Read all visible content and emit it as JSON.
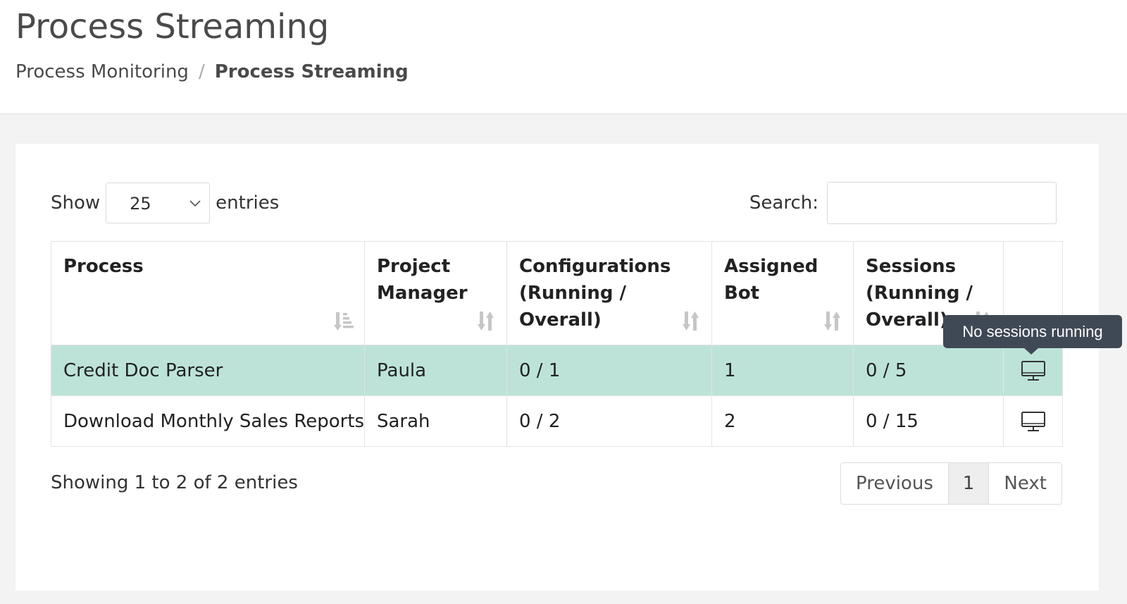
{
  "page": {
    "title": "Process Streaming",
    "breadcrumb": [
      {
        "label": "Process Monitoring"
      },
      {
        "separator": "/"
      },
      {
        "label": "Process Streaming"
      }
    ]
  },
  "controls": {
    "show_label": "Show",
    "entries_label": "entries",
    "page_length": "25",
    "search_label": "Search:",
    "search_value": ""
  },
  "table": {
    "columns": [
      {
        "label": "Process",
        "sort": "ascending"
      },
      {
        "label": "Project Manager",
        "sort": "sortable"
      },
      {
        "label": "Configurations (Running / Overall)",
        "sort": "sortable"
      },
      {
        "label": "Assigned Bot",
        "sort": "sortable"
      },
      {
        "label": "Sessions (Running / Overall)",
        "sort": "sortable"
      },
      {
        "label": ""
      }
    ],
    "rows": [
      {
        "process": "Credit Doc Parser",
        "manager": "Paula",
        "configurations": "0 / 1",
        "bot": "1",
        "sessions": "0 / 5",
        "action_icon": "monitor-icon",
        "highlighted": true
      },
      {
        "process": "Download Monthly Sales Reports",
        "manager": "Sarah",
        "configurations": "0 / 2",
        "bot": "2",
        "sessions": "0 / 15",
        "action_icon": "monitor-icon",
        "highlighted": false
      }
    ]
  },
  "footer": {
    "info": "Showing 1 to 2 of 2 entries",
    "pagination": {
      "previous": "Previous",
      "current": "1",
      "next": "Next"
    }
  },
  "tooltip": {
    "text": "No sessions running"
  },
  "colors": {
    "highlight_row": "#bde3d9",
    "tooltip_bg": "#3f4955"
  }
}
